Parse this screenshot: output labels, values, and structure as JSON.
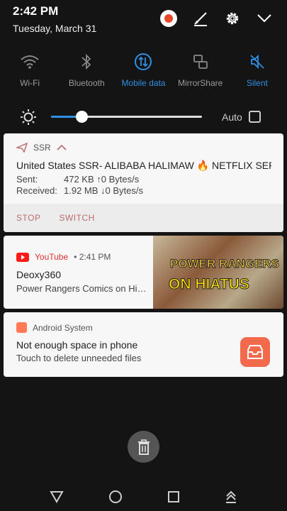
{
  "status": {
    "time": "2:42 PM",
    "date": "Tuesday, March 31"
  },
  "header_icons": [
    "avatar-icon",
    "edit-icon",
    "settings-icon",
    "chevron-down-icon"
  ],
  "toggles": [
    {
      "label": "Wi-Fi",
      "icon": "wifi-icon",
      "active": false
    },
    {
      "label": "Bluetooth",
      "icon": "bluetooth-icon",
      "active": false
    },
    {
      "label": "Mobile data",
      "icon": "mobile-data-icon",
      "active": true
    },
    {
      "label": "MirrorShare",
      "icon": "mirrorshare-icon",
      "active": false
    },
    {
      "label": "Silent",
      "icon": "silent-icon",
      "active": true
    }
  ],
  "brightness": {
    "level": 0.2,
    "auto_label": "Auto",
    "auto_checked": false
  },
  "colors": {
    "accent": "#2f8fe3",
    "youtube": "#ff1a1a",
    "system": "#f26a4b",
    "action": "#b96b6e"
  },
  "notifications": {
    "ssr": {
      "app": "SSR",
      "title": "United States SSR- ALIBABA HALIMAW 🔥 NETFLIX SERV…",
      "sent_label": "Sent:",
      "sent_value": "472 KB ↑0 Bytes/s",
      "received_label": "Received:",
      "received_value": "1.92 MB ↓0 Bytes/s",
      "actions": [
        "STOP",
        "SWITCH"
      ]
    },
    "youtube": {
      "app": "YouTube",
      "time": "• 2:41 PM",
      "title": "Deoxy360",
      "subtitle": "Power Rangers Comics on Hi…",
      "thumb_line1": "POWER RANGERS",
      "thumb_line2": "ON HIATUS"
    },
    "system": {
      "app": "Android System",
      "title": "Not enough space in phone",
      "subtitle": "Touch to delete unneeded files"
    }
  },
  "nav": [
    "back-icon",
    "home-icon",
    "recents-icon",
    "notification-dismiss-icon"
  ]
}
